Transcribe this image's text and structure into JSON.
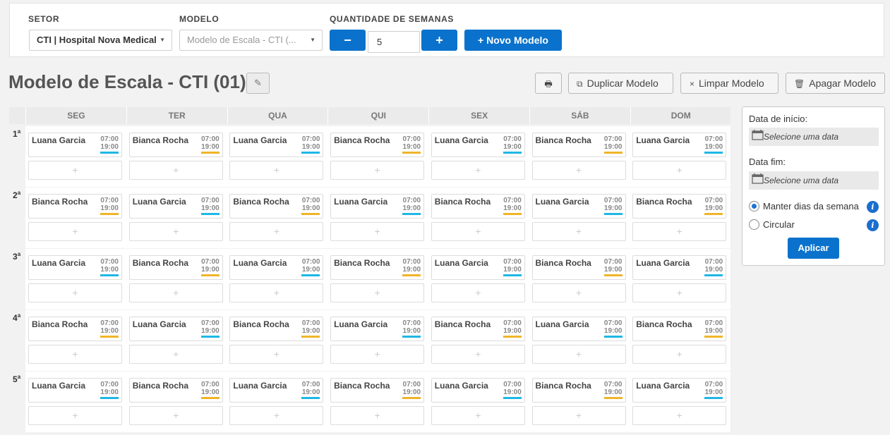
{
  "filters": {
    "setor_label": "SETOR",
    "setor_value": "CTI | Hospital Nova Medical",
    "modelo_label": "MODELO",
    "modelo_value": "Modelo de Escala - CTI (...",
    "qtd_label": "QUANTIDADE DE SEMANAS",
    "qtd_minus": "−",
    "qtd_value": "5",
    "qtd_plus": "+",
    "novo_modelo": "+ Novo Modelo",
    "caret_icon": "caret-down-icon"
  },
  "title": {
    "text": "Modelo de Escala - CTI (01)",
    "edit_icon": "✎",
    "print_icon": "🖶",
    "duplicar": "Duplicar Modelo",
    "duplicar_icon": "⧉",
    "limpar": "Limpar Modelo",
    "limpar_icon": "×",
    "apagar": "Apagar Modelo",
    "apagar_icon": "🗑"
  },
  "days": [
    "SEG",
    "TER",
    "QUA",
    "QUI",
    "SEX",
    "SÁB",
    "DOM"
  ],
  "weeks": [
    {
      "num": "1",
      "sup": "a",
      "names": [
        "Luana Garcia",
        "Bianca Rocha",
        "Luana Garcia",
        "Bianca Rocha",
        "Luana Garcia",
        "Bianca Rocha",
        "Luana Garcia"
      ]
    },
    {
      "num": "2",
      "sup": "a",
      "names": [
        "Bianca Rocha",
        "Luana Garcia",
        "Bianca Rocha",
        "Luana Garcia",
        "Bianca Rocha",
        "Luana Garcia",
        "Bianca Rocha"
      ]
    },
    {
      "num": "3",
      "sup": "a",
      "names": [
        "Luana Garcia",
        "Bianca Rocha",
        "Luana Garcia",
        "Bianca Rocha",
        "Luana Garcia",
        "Bianca Rocha",
        "Luana Garcia"
      ]
    },
    {
      "num": "4",
      "sup": "a",
      "names": [
        "Bianca Rocha",
        "Luana Garcia",
        "Bianca Rocha",
        "Luana Garcia",
        "Bianca Rocha",
        "Luana Garcia",
        "Bianca Rocha"
      ]
    },
    {
      "num": "5",
      "sup": "a",
      "names": [
        "Luana Garcia",
        "Bianca Rocha",
        "Luana Garcia",
        "Bianca Rocha",
        "Luana Garcia",
        "Bianca Rocha",
        "Luana Garcia"
      ]
    }
  ],
  "shift_time": {
    "start": "07:00",
    "end": "19:00"
  },
  "add_label": "+",
  "colors": {
    "Luana Garcia": "#1fb7e6",
    "Bianca Rocha": "#f0b429",
    "accent": "#0a72cc"
  },
  "panel": {
    "inicio_label": "Data de início:",
    "inicio_placeholder": "Selecione uma data",
    "fim_label": "Data fim:",
    "fim_placeholder": "Selecione uma data",
    "calendar_icon": "calendar-icon",
    "opt1": "Manter dias da semana",
    "opt1_selected": true,
    "opt2": "Circular",
    "info_icon": "i",
    "apply": "Aplicar"
  }
}
